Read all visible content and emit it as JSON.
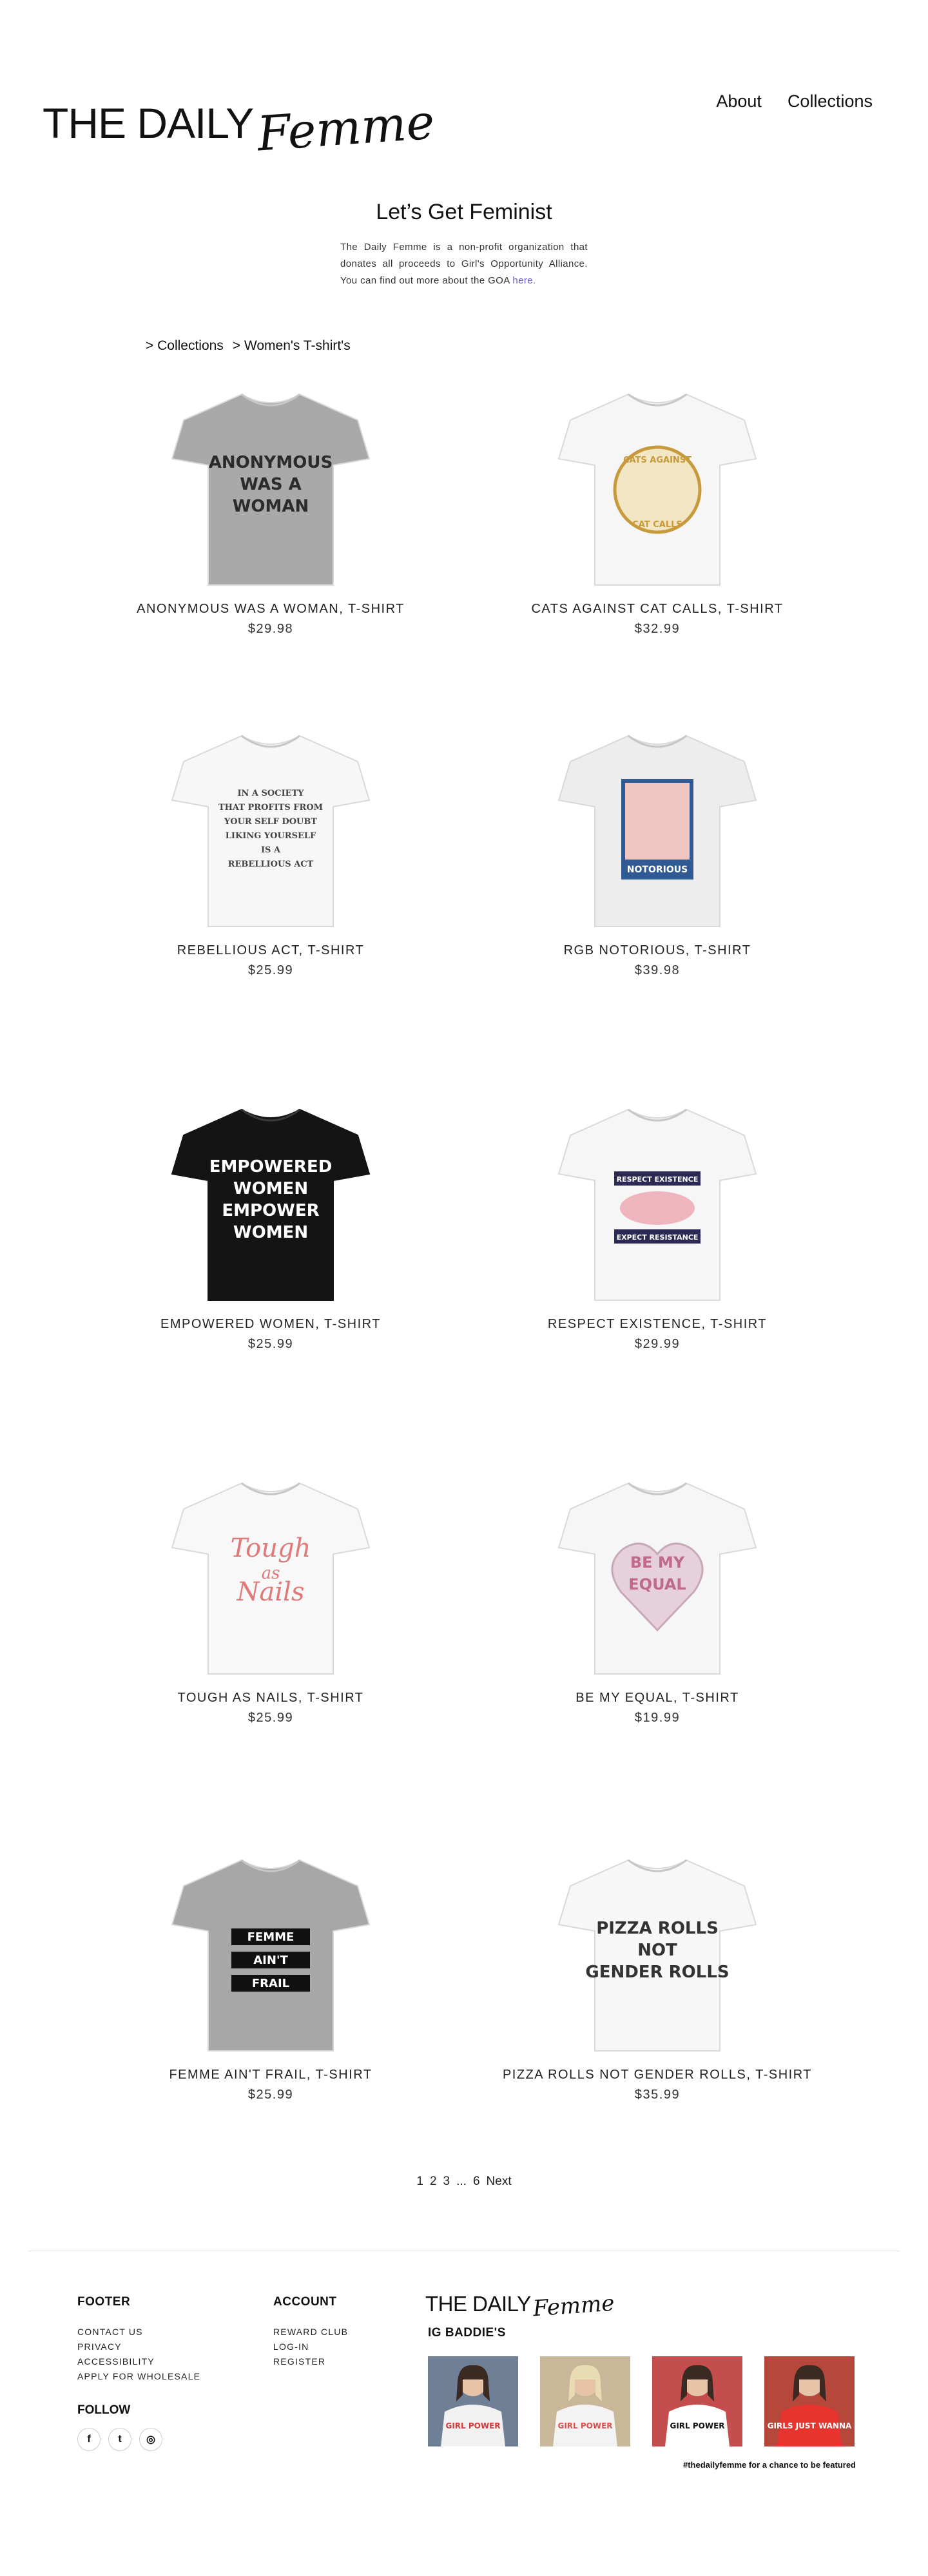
{
  "header": {
    "logo_plain": "THE DAILY",
    "logo_script": "Femme",
    "nav": [
      "About",
      "Collections"
    ]
  },
  "intro": {
    "title": "Let’s Get Feminist",
    "text": "The Daily Femme is a non-profit organization that donates all proceeds to Girl's Opportunity Alliance. You can find out more about the GOA",
    "link": "here."
  },
  "breadcrumb": [
    "> Collections",
    "> Women's T-shirt's"
  ],
  "products": [
    {
      "name": "ANONYMOUS WAS A WOMAN, T-SHIRT",
      "price": "$29.98",
      "shirt_color": "#a9a9a9",
      "print": [
        "ANONYMOUS",
        "WAS A",
        "WOMAN"
      ],
      "print_color": "#2b2b2b"
    },
    {
      "name": "CATS AGAINST CAT CALLS, T-SHIRT",
      "price": "$32.99",
      "shirt_color": "#f6f6f6",
      "print": [
        "CATS AGAINST",
        "CAT CALLS"
      ],
      "print_color": "#c79a3d"
    },
    {
      "name": "REBELLIOUS ACT, T-SHIRT",
      "price": "$25.99",
      "shirt_color": "#f7f7f7",
      "print": [
        "IN A SOCIETY",
        "THAT PROFITS FROM",
        "YOUR SELF DOUBT",
        "LIKING YOURSELF",
        "IS A",
        "REBELLIOUS ACT"
      ],
      "print_color": "#444444"
    },
    {
      "name": "RGB NOTORIOUS, T-SHIRT",
      "price": "$39.98",
      "shirt_color": "#ededed",
      "print": [
        "NOTORIOUS"
      ],
      "print_color": "#2f5a94"
    },
    {
      "name": "EMPOWERED WOMEN, T-SHIRT",
      "price": "$25.99",
      "shirt_color": "#141414",
      "print": [
        "EMPOWERED",
        "WOMEN",
        "EMPOWER",
        "WOMEN"
      ],
      "print_color": "#ffffff"
    },
    {
      "name": "RESPECT EXISTENCE, T-SHIRT",
      "price": "$29.99",
      "shirt_color": "#f6f6f6",
      "print": [
        "RESPECT EXISTENCE",
        "EXPECT RESISTANCE"
      ],
      "print_color": "#2a2a55"
    },
    {
      "name": "TOUGH AS NAILS, T-SHIRT",
      "price": "$25.99",
      "shirt_color": "#f8f8f8",
      "print": [
        "Tough",
        "as",
        "Nails"
      ],
      "print_color": "#e07a7a"
    },
    {
      "name": "BE MY EQUAL, T-SHIRT",
      "price": "$19.99",
      "shirt_color": "#f6f6f6",
      "print": [
        "BE MY",
        "EQUAL"
      ],
      "print_color": "#c06a8a"
    },
    {
      "name": "FEMME AIN'T FRAIL, T-SHIRT",
      "price": "$25.99",
      "shirt_color": "#a7a7a7",
      "print": [
        "FEMME",
        "AIN'T",
        "FRAIL"
      ],
      "print_color": "#ffffff"
    },
    {
      "name": "PIZZA ROLLS NOT GENDER ROLLS, T-SHIRT",
      "price": "$35.99",
      "shirt_color": "#f7f7f7",
      "print": [
        "PIZZA ROLLS",
        "NOT",
        "GENDER ROLLS"
      ],
      "print_color": "#333333"
    }
  ],
  "pagination": [
    "1",
    "2",
    "3",
    "...",
    "6",
    "Next"
  ],
  "footer": {
    "footer_title": "FOOTER",
    "footer_links": [
      "CONTACT US",
      "PRIVACY",
      "ACCESSIBILITY",
      "APPLY FOR WHOLESALE"
    ],
    "account_title": "ACCOUNT",
    "account_links": [
      "REWARD CLUB",
      "LOG-IN",
      "REGISTER"
    ],
    "follow_title": "FOLLOW",
    "socials": [
      {
        "icon": "facebook-icon",
        "glyph": "f"
      },
      {
        "icon": "twitter-icon",
        "glyph": "t"
      },
      {
        "icon": "instagram-icon",
        "glyph": "◎"
      }
    ],
    "logo_plain": "THE DAILY",
    "logo_script": "Femme",
    "ig_title": "IG BADDIE'S",
    "ig_posts": [
      {
        "text": "GIRL POWER",
        "bg": "#6f7f95",
        "shirt": "#f1f1f1",
        "ink": "#d23b3b"
      },
      {
        "text": "GIRL POWER",
        "bg": "#c9b79a",
        "shirt": "#f3f3f3",
        "ink": "#d9534f"
      },
      {
        "text": "GIRL POWER",
        "bg": "#c44d4d",
        "shirt": "#ffffff",
        "ink": "#111111"
      },
      {
        "text": "GIRLS JUST WANNA",
        "bg": "#b5473b",
        "shirt": "#e8342f",
        "ink": "#ffffff"
      }
    ],
    "ig_caption": "#thedailyfemme for a chance to be featured"
  }
}
